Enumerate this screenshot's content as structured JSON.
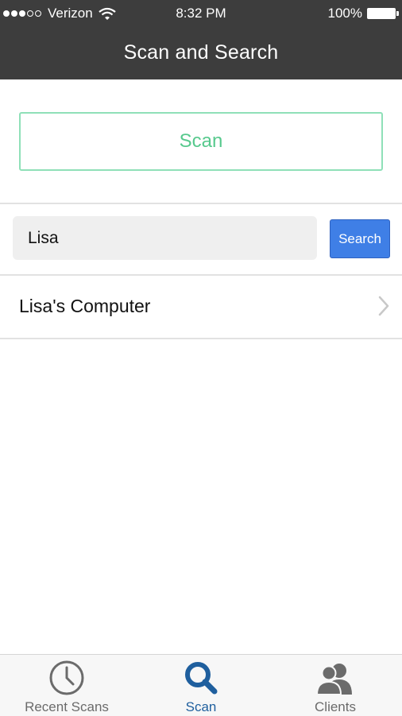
{
  "status_bar": {
    "carrier": "Verizon",
    "time": "8:32 PM",
    "battery": "100%",
    "signal_bars_filled": 3,
    "signal_bars_total": 5
  },
  "nav": {
    "title": "Scan and Search"
  },
  "scan_button": {
    "label": "Scan"
  },
  "search": {
    "value": "Lisa",
    "button_label": "Search"
  },
  "results": [
    {
      "label": "Lisa's Computer"
    }
  ],
  "tabs": [
    {
      "label": "Recent Scans",
      "icon": "clock-icon",
      "active": false
    },
    {
      "label": "Scan",
      "icon": "magnifier-icon",
      "active": true
    },
    {
      "label": "Clients",
      "icon": "people-icon",
      "active": false
    }
  ],
  "colors": {
    "bar": "#3d3d3d",
    "scan_accent": "#57c98d",
    "search_button": "#3f7fe6",
    "active_tab": "#1f5f9e"
  }
}
